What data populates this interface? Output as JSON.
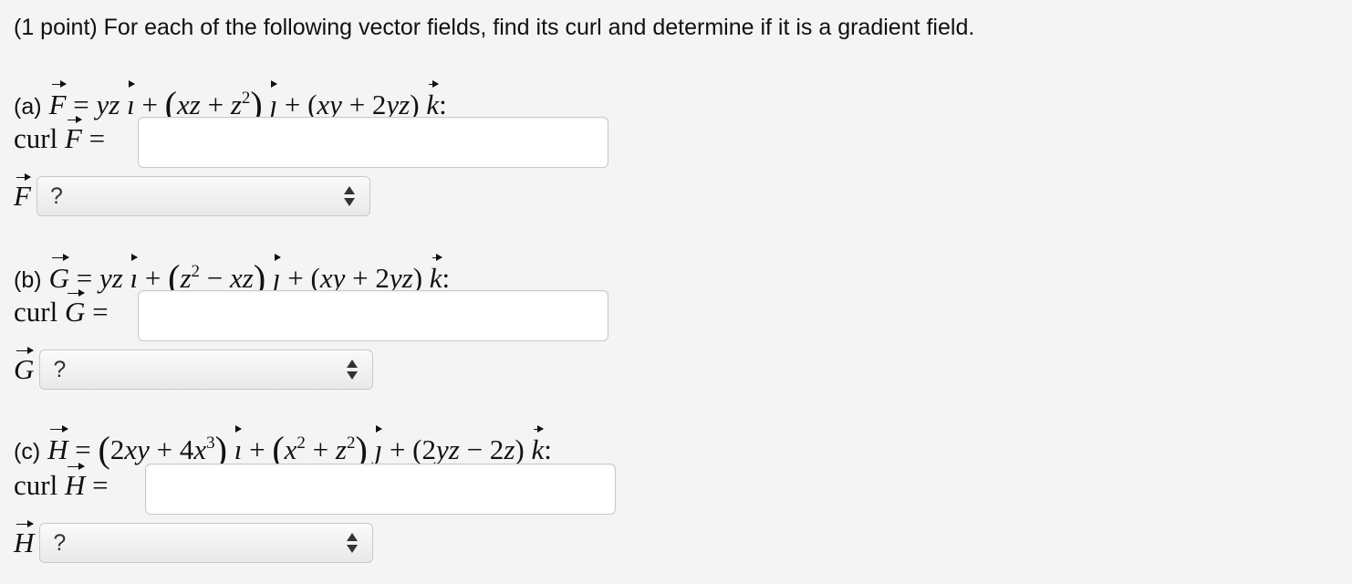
{
  "intro": "(1 point) For each of the following vector fields, find its curl and determine if it is a gradient field.",
  "parts": [
    {
      "label": "(a)",
      "field": "F",
      "curl_prefix": "curl",
      "select_value": "?"
    },
    {
      "label": "(b)",
      "field": "G",
      "curl_prefix": "curl",
      "select_value": "?"
    },
    {
      "label": "(c)",
      "field": "H",
      "curl_prefix": "curl",
      "select_value": "?"
    }
  ],
  "colors": {
    "background": "#f4f4f4",
    "input_border": "#c9c9c9"
  }
}
